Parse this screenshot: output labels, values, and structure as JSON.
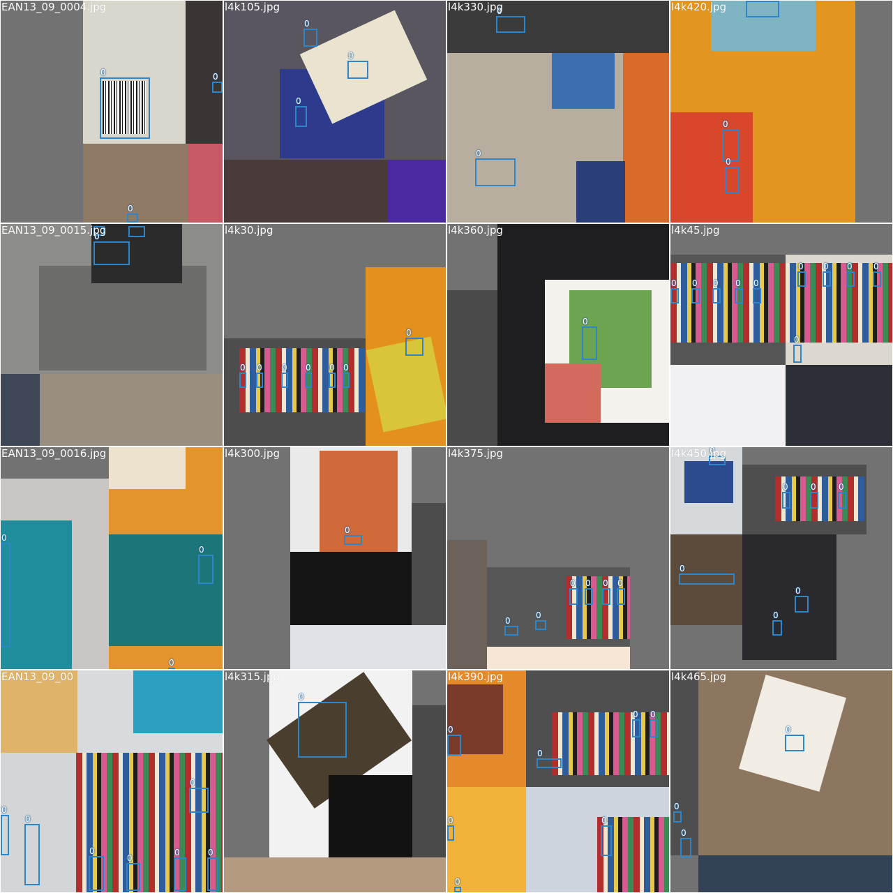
{
  "mosaic": {
    "label_glyph": "0",
    "box_color": "#2d86c9",
    "tiles": [
      {
        "filename": "EAN13_09_0004.jpg"
      },
      {
        "filename": "l4k105.jpg"
      },
      {
        "filename": "l4k330.jpg"
      },
      {
        "filename": "l4k420.jpg"
      },
      {
        "filename": "EAN13_09_0015.jpg"
      },
      {
        "filename": "l4k30.jpg"
      },
      {
        "filename": "l4k360.jpg"
      },
      {
        "filename": "l4k45.jpg"
      },
      {
        "filename": "EAN13_09_0016.jpg"
      },
      {
        "filename": "l4k300.jpg"
      },
      {
        "filename": "l4k375.jpg"
      },
      {
        "filename": "l4k450.jpg"
      },
      {
        "filename": "EAN13_09_00"
      },
      {
        "filename": "l4k315.jpg"
      },
      {
        "filename": "l4k390.jpg"
      },
      {
        "filename": "l4k465.jpg"
      }
    ]
  }
}
